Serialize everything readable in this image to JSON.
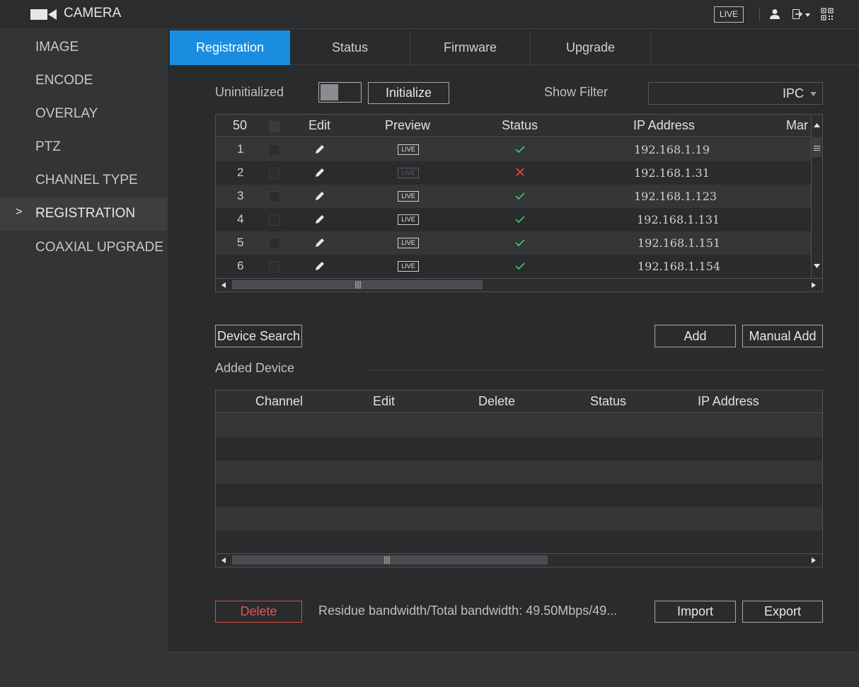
{
  "app": {
    "title": "CAMERA",
    "live_label": "LIVE"
  },
  "colors": {
    "accent": "#1a8de0",
    "ok": "#3cc85a",
    "error": "#e0453a",
    "danger": "#d84b3e"
  },
  "sidebar": {
    "items": [
      {
        "label": "IMAGE"
      },
      {
        "label": "ENCODE"
      },
      {
        "label": "OVERLAY"
      },
      {
        "label": "PTZ"
      },
      {
        "label": "CHANNEL TYPE"
      },
      {
        "label": "REGISTRATION",
        "active": true,
        "arrow": ">"
      },
      {
        "label": "COAXIAL UPGRADE"
      }
    ]
  },
  "tabs": [
    {
      "label": "Registration",
      "active": true
    },
    {
      "label": "Status"
    },
    {
      "label": "Firmware"
    },
    {
      "label": "Upgrade"
    }
  ],
  "registration": {
    "uninitialized_label": "Uninitialized",
    "initialize_label": "Initialize",
    "show_filter_label": "Show Filter",
    "filter_value": "IPC",
    "device_table": {
      "columns": [
        "50",
        "",
        "Edit",
        "Preview",
        "Status",
        "IP Address",
        "Mar"
      ],
      "rows": [
        {
          "no": "1",
          "preview": "LIVE",
          "status": "ok",
          "ip": "192.168.1.19"
        },
        {
          "no": "2",
          "preview": "LIVE",
          "status": "error",
          "ip": "192.168.1.31"
        },
        {
          "no": "3",
          "preview": "LIVE",
          "status": "ok",
          "ip": "192.168.1.123"
        },
        {
          "no": "4",
          "preview": "LIVE",
          "status": "ok",
          "ip": "192.168.1.131"
        },
        {
          "no": "5",
          "preview": "LIVE",
          "status": "ok",
          "ip": "192.168.1.151"
        },
        {
          "no": "6",
          "preview": "LIVE",
          "status": "ok",
          "ip": "192.168.1.154"
        }
      ]
    },
    "device_search_label": "Device Search",
    "add_label": "Add",
    "manual_add_label": "Manual Add",
    "added_device_label": "Added Device",
    "added_table": {
      "columns": [
        "Channel",
        "Edit",
        "Delete",
        "Status",
        "IP Address"
      ],
      "rows": []
    },
    "delete_label": "Delete",
    "bandwidth_text": "Residue bandwidth/Total bandwidth:  49.50Mbps/49...",
    "import_label": "Import",
    "export_label": "Export"
  }
}
